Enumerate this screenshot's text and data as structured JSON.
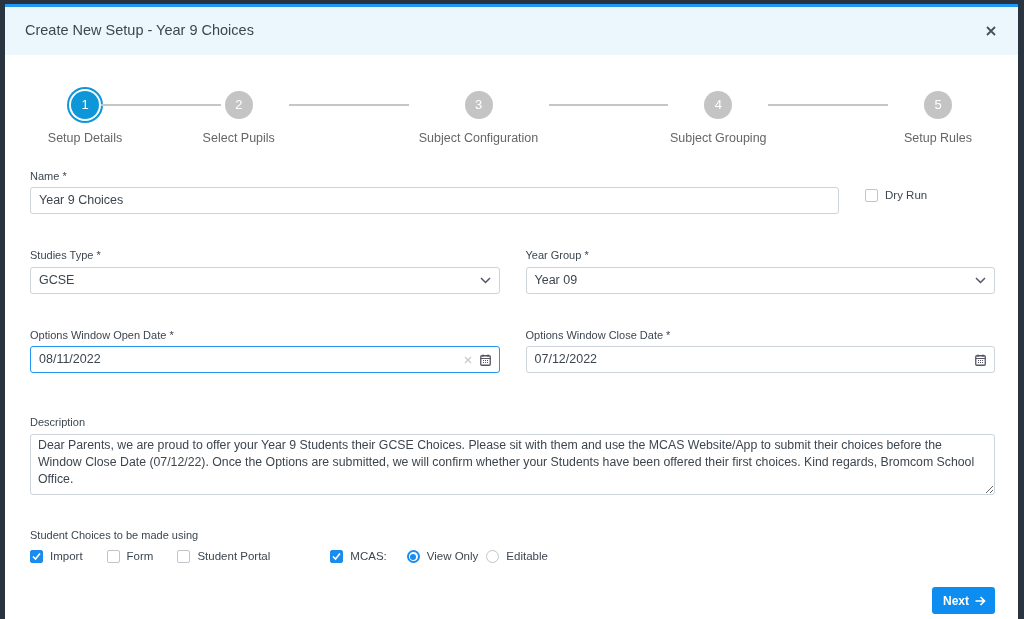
{
  "dialog": {
    "title": "Create New Setup - Year 9 Choices"
  },
  "steps": [
    {
      "number": "1",
      "label": "Setup Details",
      "active": true
    },
    {
      "number": "2",
      "label": "Select Pupils",
      "active": false
    },
    {
      "number": "3",
      "label": "Subject Configuration",
      "active": false
    },
    {
      "number": "4",
      "label": "Subject Grouping",
      "active": false
    },
    {
      "number": "5",
      "label": "Setup Rules",
      "active": false
    }
  ],
  "name_field": {
    "label": "Name *",
    "value": "Year 9 Choices"
  },
  "dry_run": {
    "label": "Dry Run",
    "checked": false
  },
  "selects": [
    {
      "label": "Studies Type *",
      "value": "GCSE"
    },
    {
      "label": "Year Group *",
      "value": "Year 09"
    }
  ],
  "dates": [
    {
      "label": "Options Window Open Date *",
      "value": "08/11/2022",
      "focused": true
    },
    {
      "label": "Options Window Close Date *",
      "value": "07/12/2022",
      "focused": false
    }
  ],
  "description": {
    "label": "Description",
    "value": "Dear Parents, we are proud to offer your Year 9 Students their GCSE Choices. Please sit with them and use the MCAS Website/App to submit their choices before the Window Close Date (07/12/22). Once the Options are submitted, we will confirm whether your Students have been offered their first choices. Kind regards, Bromcom School Office."
  },
  "choices": {
    "label": "Student Choices to be made using",
    "options": [
      {
        "label": "Import",
        "checked": true
      },
      {
        "label": "Form",
        "checked": false
      },
      {
        "label": "Student Portal",
        "checked": false
      },
      {
        "label": "MCAS:",
        "checked": true
      }
    ],
    "mcas_access": [
      {
        "label": "View Only",
        "selected": true
      },
      {
        "label": "Editable",
        "selected": false
      }
    ]
  },
  "footer": {
    "next_button": "Next"
  }
}
